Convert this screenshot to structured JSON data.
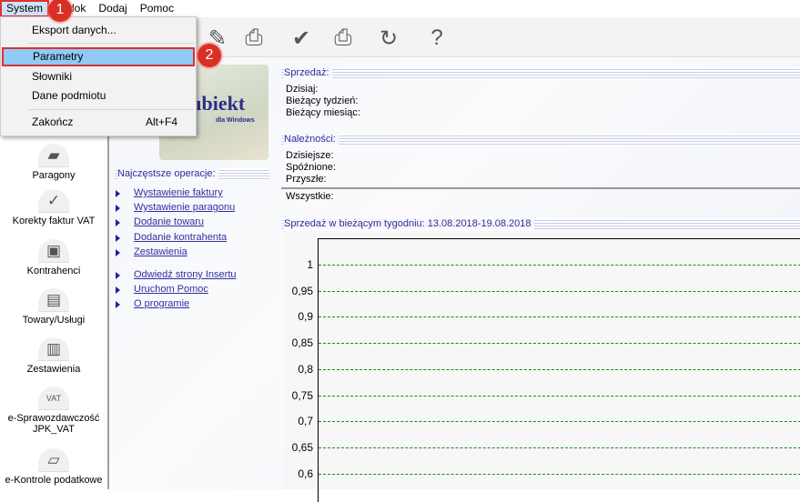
{
  "menubar": {
    "items": [
      "System",
      "Widok",
      "Dodaj",
      "Pomoc"
    ]
  },
  "dropdown": {
    "items": [
      {
        "label": "Eksport danych..."
      },
      {
        "label": "Parametry"
      },
      {
        "label": "Słowniki"
      },
      {
        "label": "Dane podmiotu"
      },
      {
        "label": "Zakończ",
        "shortcut": "Alt+F4"
      }
    ]
  },
  "badges": [
    "1",
    "2"
  ],
  "toolbar": {
    "icons": [
      "pen-icon",
      "printer-icon",
      "approve-hand-icon",
      "fax-printer-icon",
      "refresh-icon",
      "help-icon"
    ]
  },
  "sidebar": {
    "items": [
      "Paragony",
      "Korekty faktur VAT",
      "Kontrahenci",
      "Towary/Usługi",
      "Zestawienia",
      "e-Sprawozdawczość JPK_VAT",
      "e-Kontrole podatkowe"
    ]
  },
  "logo": {
    "title": "Subiekt",
    "subtitle": "dla Windows"
  },
  "operations": {
    "header": "Najczęstsze operacje:",
    "links": [
      "Wystawienie faktury",
      "Wystawienie paragonu",
      "Dodanie towaru",
      "Dodanie kontrahenta",
      "Zestawienia",
      "Odwiedź strony Insertu",
      "Uruchom Pomoc",
      "O programie"
    ]
  },
  "sales": {
    "header": "Sprzedaż:",
    "labels": [
      "Dzisiaj:",
      "Bieżący tydzień:",
      "Bieżący miesiąc:"
    ]
  },
  "receivables": {
    "header": "Należności:",
    "labels": [
      "Dzisiejsze:",
      "Spóźnione:",
      "Przyszłe:"
    ],
    "total": "Wszystkie:"
  },
  "chart_data": {
    "type": "line",
    "title": "Sprzedaż w bieżącym tygodniu: 13.08.2018-19.08.2018",
    "yticks": [
      "1",
      "0,95",
      "0,9",
      "0,85",
      "0,8",
      "0,75",
      "0,7",
      "0,65",
      "0,6"
    ],
    "ytick_values": [
      1,
      0.95,
      0.9,
      0.85,
      0.8,
      0.75,
      0.7,
      0.65,
      0.6
    ],
    "grid": true,
    "series": []
  }
}
